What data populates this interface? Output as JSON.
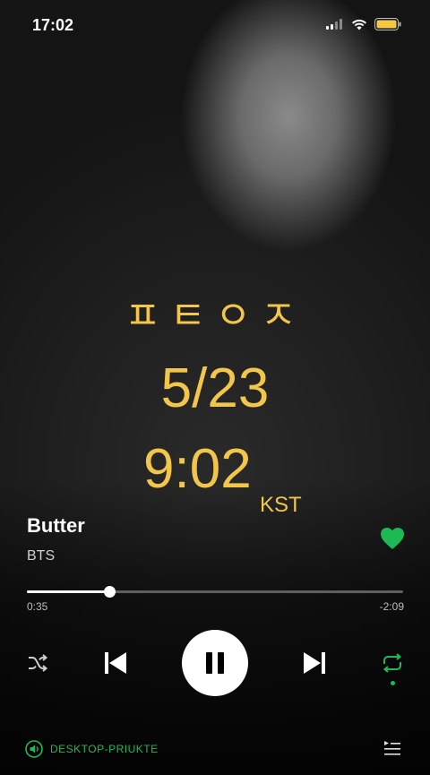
{
  "status_bar": {
    "time": "17:02"
  },
  "overlay": {
    "korean_text": "ㅍㅌㅇㅈ",
    "date": "5/23",
    "time": "9:02",
    "timezone": "KST",
    "text_color": "#f2c64a"
  },
  "track": {
    "title": "Butter",
    "artist": "BTS",
    "liked": true
  },
  "progress": {
    "elapsed": "0:35",
    "remaining": "-2:09",
    "fraction": 0.22
  },
  "controls": {
    "shuffle": "shuffle-icon",
    "previous": "skip-back-icon",
    "play_pause": "pause-icon",
    "next": "skip-forward-icon",
    "repeat": "repeat-icon",
    "repeat_active": true
  },
  "footer": {
    "device_label": "DESKTOP-PRIUKTE",
    "queue": "queue-icon"
  },
  "colors": {
    "accent": "#1db954",
    "overlay_text": "#f2c64a"
  }
}
